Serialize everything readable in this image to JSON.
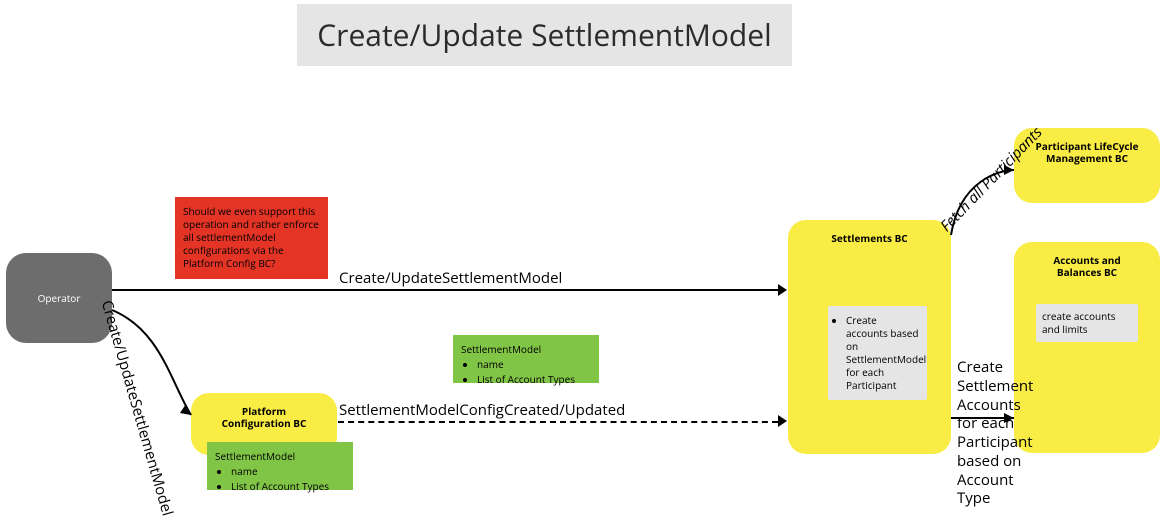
{
  "title": "Create/Update SettlementModel",
  "nodes": {
    "operator": "Operator",
    "platform_config_bc": "Platform Configuration BC",
    "settlements_bc": "Settlements BC",
    "lifecycle_bc": "Participant LifeCycle Management BC",
    "accounts_bc": "Accounts and Balances BC"
  },
  "notes": {
    "red_question": "Should we even support this operation and rather enforce all settlementModel configurations via the Platform Config BC?",
    "green_model_inline": {
      "title": "SettlementModel",
      "items": [
        "name",
        "List of Account Types"
      ]
    },
    "green_model_below_pc": {
      "title": "SettlementModel",
      "items": [
        "name",
        "List of Account Types"
      ]
    },
    "settlements_inner": {
      "items": [
        "Create accounts based on SettlementModel for each Participant"
      ]
    },
    "accounts_inner": "create accounts and limits"
  },
  "edges": {
    "op_to_settlements": "Create/UpdateSettlementModel",
    "op_to_pc": "Create/UpdateSettlementModel",
    "pc_to_settlements": "SettlementModelConfigCreated/Updated",
    "settlements_to_lifecycle": "Fetch all Participants",
    "settlements_to_accounts": "Create Settlement Accounts for each Participant based on Account Type"
  },
  "colors": {
    "title_bg": "#e5e5e5",
    "operator_bg": "#6d6d6d",
    "bc_bg": "#f9ec44",
    "red": "#e43426",
    "green": "#81c547"
  }
}
